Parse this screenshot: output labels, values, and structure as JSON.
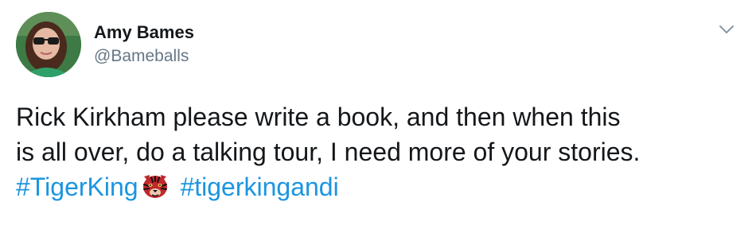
{
  "author": {
    "display_name": "Amy Bames",
    "handle": "@Bameballs"
  },
  "icons": {
    "menu": "chevron-down-icon",
    "emoji": "tiger-face-icon"
  },
  "tweet": {
    "line1": "Rick Kirkham please write a book, and then when this",
    "line2": "is all over, do a talking tour, I need more of your stories.",
    "hashtag1": "#TigerKing",
    "hashtag2": "#tigerkingandi"
  },
  "colors": {
    "text": "#14171a",
    "secondary": "#657786",
    "link": "#1b95e0"
  }
}
